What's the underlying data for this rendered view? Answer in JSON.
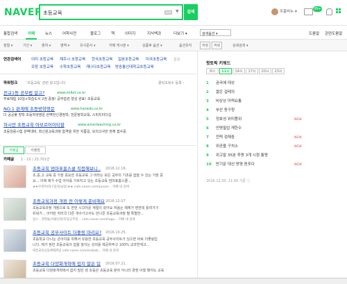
{
  "header": {
    "logo": "NAVER",
    "search_value": "초등교육",
    "search_button": "검색",
    "user_name": "우홍비누 ▾",
    "noti_count": "99+"
  },
  "tabs": [
    "통합검색",
    "카페",
    "뉴스",
    "어학사전",
    "블로그",
    "책",
    "이미지",
    "지식백과",
    "더보기 ▾"
  ],
  "option_label": "검색옵션 ▾",
  "right_links": [
    "도움말",
    "관련도움말"
  ],
  "filters": [
    "정렬 ▾",
    "기간 ▾",
    "출처 ▾",
    "영역 ▾",
    "유사문서 ▾",
    "카페 게시판 ▾",
    "상품후 옵션 ▾",
    "옵션유지",
    "꺼짐",
    "켜짐",
    "상세검색 ▾"
  ],
  "related": {
    "label": "연관검색어",
    "row1": [
      "이미 초등교육",
      "제주시 초등교육",
      "한국초등교육",
      "일본초등교육",
      "미국초등교육"
    ],
    "row2": [
      "프랑 초등교육",
      "수학초등교육",
      "캐나다초등교육",
      "방송통신대학교초등교육"
    ],
    "report": "신고"
  },
  "powerlink": {
    "label": "파워링크",
    "query_label": "'초등교육' 관련 광고입니다",
    "register": "클릭조회수 등록 ›",
    "ads": [
      {
        "title": "전교1등 공부법 알고?",
        "url": "www.millet.co.kr",
        "desc": "무료체험 10일+학습도서 2권 증정! 공부습관 형성 완료! 초등교육"
      },
      {
        "title": "NO.1 완게에 초등방학영문",
        "url": "www.hanedu.co.kr",
        "desc": "다 공공풀 방학 초등학생영문 완벽한신경정학, 전문정학교육, 스피치리더십"
      },
      {
        "title": "하시만 초등교육 아모르어이티할",
        "url": "www.amorteaching.co.kr",
        "desc": "초등임용시험 완벽대비, 최신원교육과정 합격을 위한 지름길, 모의고사반 현재 접수중"
      }
    ]
  },
  "cafe": {
    "sub_tabs": [
      "카페글",
      "카페명"
    ],
    "label": "카페글",
    "count": "1 - 10 / 25,701건",
    "items": [
      {
        "title": "초등교육 엄마표홈스쿨 직접해보니..",
        "date": "2016.12.16.",
        "desc1": "초,중,고 교육 중 가장 중요한 초등교육 그 마라는 모든 공부의 기초를 잡을 수 있는 가장 중",
        "desc2": "요... 이제 제가 수업 아이를 가르치고 있는 초등교육 엄마표홈스쿨...",
        "meta": "★★우경이(대구맘/동남맘)★★  cafe.naver.com/pusan...  카페 내 검색"
      },
      {
        "title": "초등교육과정 개정 전 이렇게 준비해요",
        "date": "2016.12.07.",
        "desc1": "초등교육과정 개정으로 또 한번 시끄러운 계절이 왔어요 처음는 예체가 편한데 틀려가기",
        "desc2": "쉬워가... 아카탄 처리국 다른 개수가고서도 만나픈 초등교육과정 별 특별한...",
        "meta": "맘스 - 경영들/서울인천/초등공부방...  cafe.naver.com/kagu...  카페 내 검색"
      },
      {
        "title": "초등교육 공부사이트 더좋링 마리요?",
        "date": "2016.10.25.",
        "desc1": "초등학교 다니는 큰아이를 위해서 유용한 초등교육 공부사이트가 있으면 바로 더좋링입",
        "desc2": "니다. 제가 정한 초등교육의 힘을 높이는 강의를 제공하주고 100% 교과연계고...",
        "meta": "대전교육공동체해피맘  cafe.naver.com/mobab...  카페 내 검색"
      },
      {
        "title": "초등교육 다양화개혁에 업지 말은 일",
        "date": "2016.07.21.",
        "desc1": "초등교육 다양화개혁에서 쉽지 말은 점 초등은 초등교육 분야 아니라 경쟁 이행 했어도 교육",
        "desc2": "",
        "meta": ""
      }
    ]
  },
  "hot": {
    "title": "핫토픽 키워드",
    "tabs": [
      "8시",
      "11시",
      "14시",
      "17시",
      "20시",
      "23시"
    ],
    "items": [
      {
        "rank": "1",
        "kw": "곰국에 대상",
        "badge": ""
      },
      {
        "rank": "2",
        "kw": "쌀은 걸레의",
        "badge": ""
      },
      {
        "rank": "3",
        "kw": "비상상 미력요통",
        "badge": ""
      },
      {
        "rank": "4",
        "kw": "부산 동구청",
        "badge": ""
      },
      {
        "rank": "5",
        "kw": "정호성 위미품위",
        "badge": "NEW"
      },
      {
        "rank": "6",
        "kw": "안명필업 캐한수",
        "badge": ""
      },
      {
        "rank": "7",
        "kw": "전력 검재중",
        "badge": "NEW"
      },
      {
        "rank": "8",
        "kw": "위공을 구치소",
        "badge": "NEW"
      },
      {
        "rank": "9",
        "kw": "위고말 35분 추명 3개 시점 통령",
        "badge": ""
      },
      {
        "rank": "10",
        "kw": "반기문 대선 방명 동포다",
        "badge": "NEW"
      }
    ],
    "footer": "2016.12.30. 11:00 기준 ⓘ"
  }
}
